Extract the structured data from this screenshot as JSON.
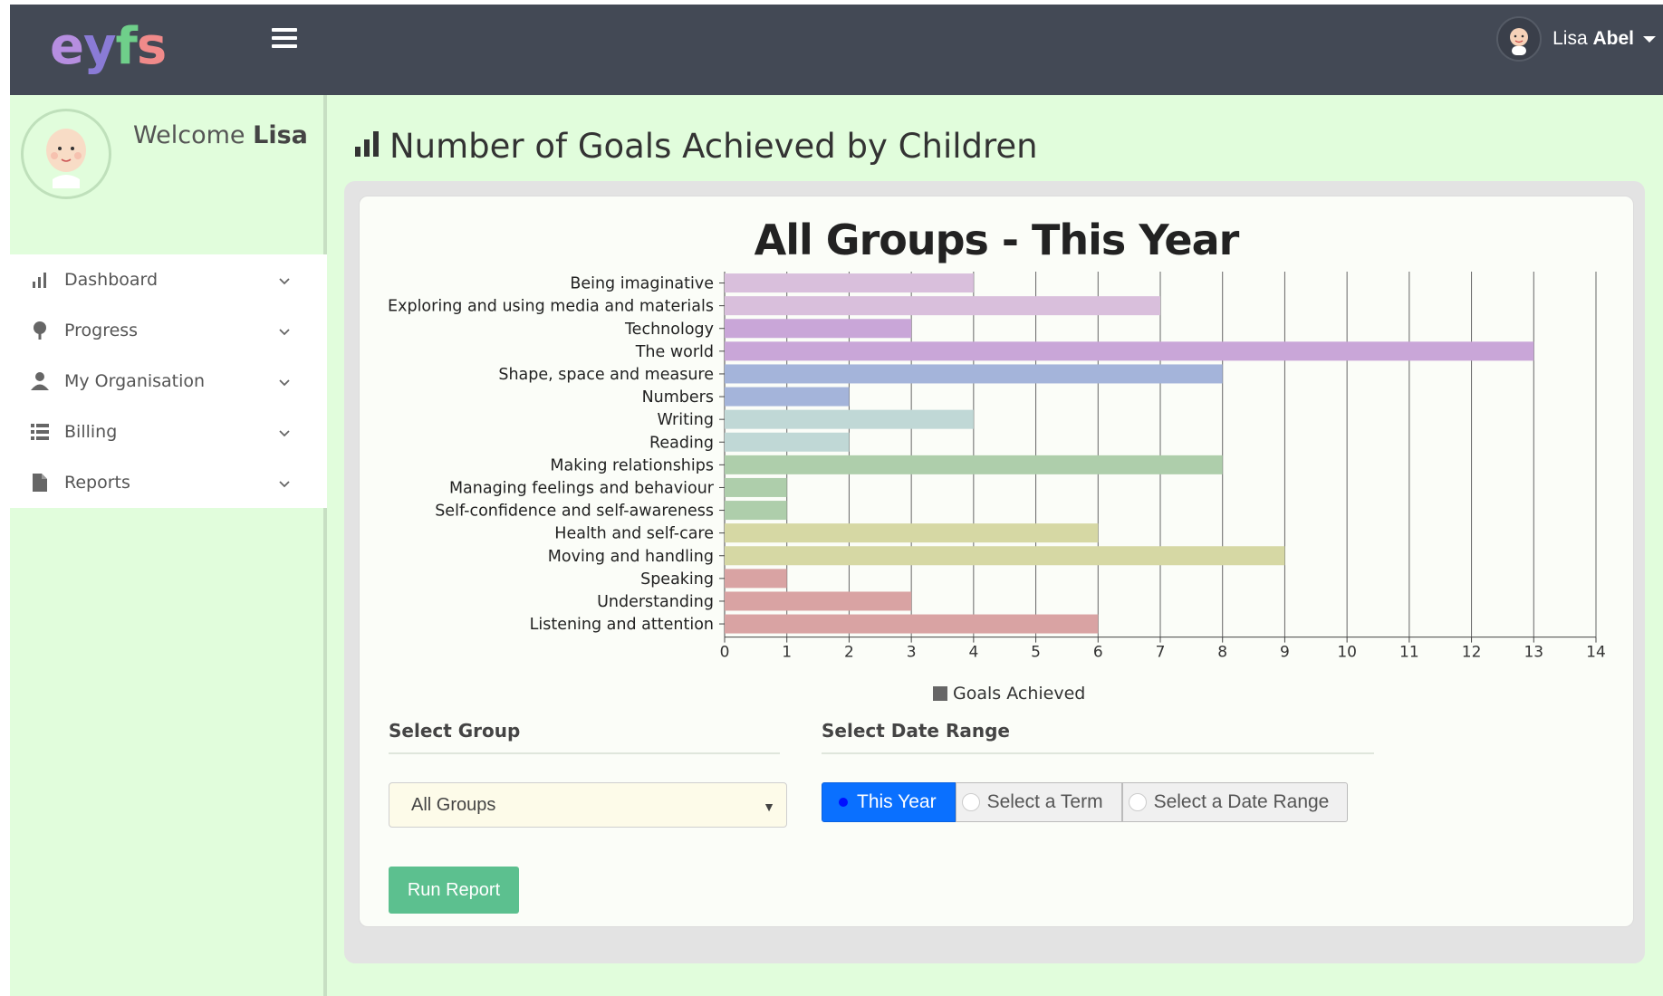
{
  "app": {
    "logo_letters": [
      "e",
      "y",
      "f",
      "s"
    ]
  },
  "header": {
    "user_first": "Lisa",
    "user_last": "Abel"
  },
  "sidebar": {
    "welcome": "Welcome",
    "welcome_name": "Lisa",
    "items": [
      {
        "label": "Dashboard",
        "icon": "bar-chart-icon"
      },
      {
        "label": "Progress",
        "icon": "tree-icon"
      },
      {
        "label": "My Organisation",
        "icon": "user-icon"
      },
      {
        "label": "Billing",
        "icon": "list-icon"
      },
      {
        "label": "Reports",
        "icon": "document-icon"
      }
    ]
  },
  "page": {
    "title": "Number of Goals Achieved by Children"
  },
  "chart_data": {
    "type": "bar",
    "orientation": "horizontal",
    "title": "All Groups - This Year",
    "categories": [
      "Being imaginative",
      "Exploring and using media and materials",
      "Technology",
      "The world",
      "Shape, space and measure",
      "Numbers",
      "Writing",
      "Reading",
      "Making relationships",
      "Managing feelings and behaviour",
      "Self-confidence and self-awareness",
      "Health and self-care",
      "Moving and handling",
      "Speaking",
      "Understanding",
      "Listening and attention"
    ],
    "series": [
      {
        "name": "Goals Achieved",
        "values": [
          4,
          7,
          3,
          13,
          8,
          2,
          4,
          2,
          8,
          1,
          1,
          6,
          9,
          1,
          3,
          6
        ]
      }
    ],
    "colors": [
      "#d9bfdc",
      "#d9bfdc",
      "#c9a6d8",
      "#c9a6d8",
      "#a4b4da",
      "#a4b4da",
      "#c0d8d6",
      "#c0d8d6",
      "#aeceab",
      "#aeceab",
      "#aeceab",
      "#d6d8a4",
      "#d6d8a4",
      "#d9a3a3",
      "#d9a3a3",
      "#d9a3a3"
    ],
    "xlim": [
      0,
      14
    ],
    "x_ticks": [
      "0",
      "1",
      "2",
      "3",
      "4",
      "5",
      "6",
      "7",
      "8",
      "9",
      "10",
      "11",
      "12",
      "13",
      "14"
    ],
    "grid": true,
    "legend": "bottom-center"
  },
  "legend": {
    "label": "Goals Achieved"
  },
  "filters": {
    "group_label": "Select Group",
    "group_value": "All Groups",
    "date_label": "Select Date Range",
    "date_options": [
      "This Year",
      "Select a Term",
      "Select a Date Range"
    ],
    "date_selected": "This Year"
  },
  "actions": {
    "run_report": "Run Report"
  }
}
